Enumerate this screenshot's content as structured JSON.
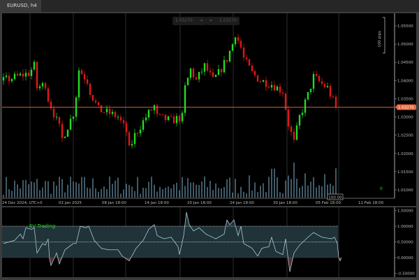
{
  "tab": {
    "label": "EURUSD, h4"
  },
  "crosshair_chips": {
    "left": "1.03270",
    "right": "1.03270",
    "arrow": "➔"
  },
  "price_axis": {
    "labels": [
      "1.05500",
      "1.05000",
      "1.04500",
      "1.04000",
      "1.03500",
      "1.03000",
      "1.02500",
      "1.02000",
      "1.01500",
      "1.01000"
    ],
    "current_price": "1.03270",
    "pips_ruler": "100 pips"
  },
  "time_axis": {
    "labels": [
      "24 Dec 2024, UTC+0",
      "02 Jan 2025",
      "08 Jan 18:00",
      "14 Jan 18:00",
      "20 Jan 18:00",
      "24 Jan 18:00",
      "30 Jan 18:00",
      "05 Feb 18:00",
      "11 Feb 18:00"
    ]
  },
  "volume": {
    "label": "100.00",
    "counter": "0"
  },
  "indicator": {
    "name": "EV Trading",
    "axis_labels": [
      "1.50000",
      "1.00000",
      "0.50000",
      "0.00000",
      "-0.50000"
    ]
  },
  "colors": {
    "bull": "#22dd22",
    "bear": "#e01818",
    "price_line": "#e8663c",
    "band": "#1f3338",
    "line": "#a8c8d8",
    "negative": "#5a2a2e",
    "indicator_label": "#22dd22"
  },
  "chart_data": {
    "type": "candlestick",
    "candle_count": 120,
    "price_path": [
      [
        0,
        1.04
      ],
      [
        9,
        1.042
      ],
      [
        11,
        1.044
      ],
      [
        12,
        1.038
      ],
      [
        15,
        1.039
      ],
      [
        16,
        1.035
      ],
      [
        20,
        1.027
      ],
      [
        21,
        1.024
      ],
      [
        25,
        1.031
      ],
      [
        26,
        1.036
      ],
      [
        27,
        1.043
      ],
      [
        30,
        1.04
      ],
      [
        31,
        1.037
      ],
      [
        34,
        1.032
      ],
      [
        38,
        1.031
      ],
      [
        41,
        1.03
      ],
      [
        44,
        1.026
      ],
      [
        45,
        1.021
      ],
      [
        47,
        1.025
      ],
      [
        51,
        1.03
      ],
      [
        54,
        1.033
      ],
      [
        55,
        1.03
      ],
      [
        60,
        1.029
      ],
      [
        64,
        1.03
      ],
      [
        65,
        1.038
      ],
      [
        67,
        1.043
      ],
      [
        69,
        1.04
      ],
      [
        72,
        1.044
      ],
      [
        75,
        1.04
      ],
      [
        77,
        1.042
      ],
      [
        80,
        1.046
      ],
      [
        82,
        1.05
      ],
      [
        83,
        1.053
      ],
      [
        85,
        1.049
      ],
      [
        86,
        1.046
      ],
      [
        89,
        1.042
      ],
      [
        92,
        1.04
      ],
      [
        96,
        1.039
      ],
      [
        100,
        1.037
      ],
      [
        102,
        1.028
      ],
      [
        104,
        1.023
      ],
      [
        106,
        1.03
      ],
      [
        109,
        1.036
      ],
      [
        111,
        1.041
      ],
      [
        114,
        1.039
      ],
      [
        116,
        1.038
      ],
      [
        119,
        1.0327
      ]
    ],
    "indicator_path": [
      [
        0,
        0.45
      ],
      [
        4,
        0.55
      ],
      [
        6,
        0.75
      ],
      [
        7,
        0.6
      ],
      [
        8,
        0.95
      ],
      [
        10,
        0.9
      ],
      [
        11,
        0.95
      ],
      [
        12,
        0.15
      ],
      [
        14,
        0.45
      ],
      [
        15,
        0.4
      ],
      [
        16,
        0.6
      ],
      [
        16.5,
        -0.05
      ],
      [
        17,
        -0.25
      ],
      [
        19,
        0.15
      ],
      [
        20,
        -0.2
      ],
      [
        22,
        0.25
      ],
      [
        25,
        0.45
      ],
      [
        26,
        0.45
      ],
      [
        27.5,
        1.0
      ],
      [
        29.5,
        0.95
      ],
      [
        30.5,
        1.0
      ],
      [
        32.5,
        0.55
      ],
      [
        35,
        0.3
      ],
      [
        37.5,
        0.25
      ],
      [
        41,
        0.25
      ],
      [
        42.5,
        0.05
      ],
      [
        45,
        -0.1
      ],
      [
        47.5,
        0.3
      ],
      [
        50,
        0.55
      ],
      [
        52,
        0.9
      ],
      [
        54,
        1.05
      ],
      [
        55,
        0.7
      ],
      [
        57.5,
        0.6
      ],
      [
        60,
        0.65
      ],
      [
        62.5,
        0.35
      ],
      [
        63,
        0.1
      ],
      [
        64.5,
        0.7
      ],
      [
        65.5,
        1.45
      ],
      [
        66.5,
        1.05
      ],
      [
        68,
        0.85
      ],
      [
        70,
        0.95
      ],
      [
        72.5,
        0.75
      ],
      [
        76,
        0.6
      ],
      [
        79,
        0.75
      ],
      [
        80,
        1.2
      ],
      [
        81,
        1.05
      ],
      [
        82.5,
        1.2
      ],
      [
        84,
        0.7
      ],
      [
        85,
        1.0
      ],
      [
        86,
        0.45
      ],
      [
        89,
        0.3
      ],
      [
        91,
        0.05
      ],
      [
        92.5,
        0.3
      ],
      [
        95,
        0.35
      ],
      [
        96,
        0.65
      ],
      [
        97.5,
        0.2
      ],
      [
        100,
        0.1
      ],
      [
        101,
        0.6
      ],
      [
        102,
        -0.1
      ],
      [
        102.5,
        -0.45
      ],
      [
        104,
        0.15
      ],
      [
        106,
        0.4
      ],
      [
        109,
        0.65
      ],
      [
        111,
        0.8
      ],
      [
        114,
        0.65
      ],
      [
        117.5,
        0.6
      ],
      [
        118.5,
        0.65
      ],
      [
        119.5,
        0.45
      ],
      [
        120,
        0.0
      ],
      [
        120.5,
        -0.1
      ],
      [
        121,
        0.0
      ]
    ],
    "price_range": [
      1.0055,
      1.0575
    ],
    "indicator_range": [
      -0.55,
      1.6
    ]
  }
}
